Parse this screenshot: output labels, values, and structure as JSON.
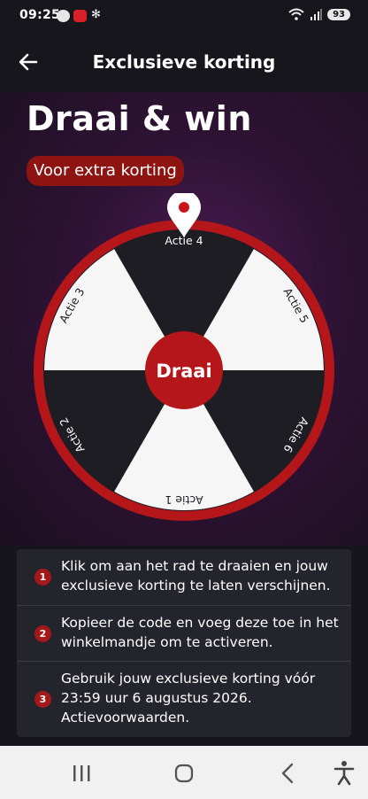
{
  "status_bar": {
    "time": "09:25",
    "battery": "93",
    "icons": [
      "app-notification-icon",
      "app-notification-icon",
      "fan-icon",
      "wifi-icon",
      "signal-icon",
      "battery-icon"
    ]
  },
  "header": {
    "title": "Exclusieve korting",
    "back_icon": "arrow-left-icon"
  },
  "hero": {
    "heading": "Draai & win",
    "badge": "Voor extra korting"
  },
  "wheel": {
    "center_label": "Draai",
    "segments": [
      "Actie 4",
      "Actie 5",
      "Actie 6",
      "Actie 1",
      "Actie 2",
      "Actie 3"
    ],
    "colors": {
      "dark": "#1e1d24",
      "light": "#f6f6f6",
      "rim": "#b5161a",
      "hub": "#b5161a"
    }
  },
  "steps": [
    {
      "number": "1",
      "text_line1": "Klik om aan het rad te draaien en jouw",
      "text_line2": "exclusieve korting te laten verschijnen.",
      "text_line3": ""
    },
    {
      "number": "2",
      "text_line1": "Kopieer de code en voeg deze toe in het",
      "text_line2": "winkelmandje om te activeren.",
      "text_line3": ""
    },
    {
      "number": "3",
      "text_line1": "Gebruik jouw exclusieve korting vóór",
      "text_line2": "23:59 uur 6 augustus 2026.",
      "text_line3": "Actievoorwaarden."
    }
  ],
  "nav_bar": {
    "items": [
      "recent-apps-icon",
      "home-icon",
      "back-icon",
      "accessibility-icon"
    ]
  },
  "colors": {
    "accent": "#a3191a",
    "background": "#15151b",
    "card": "#24242d"
  }
}
